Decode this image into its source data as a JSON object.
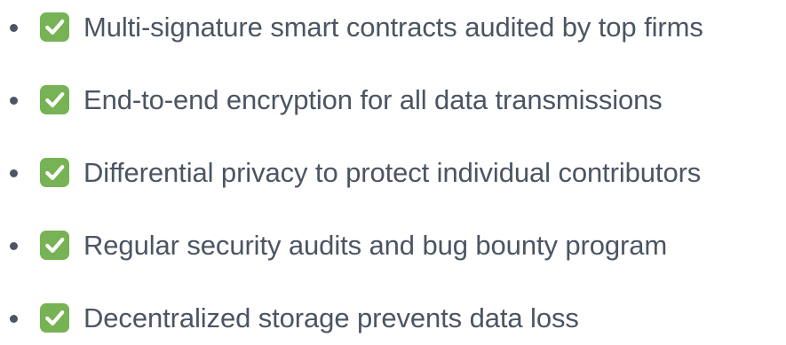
{
  "colors": {
    "text": "#4b5563",
    "bullet": "#4b5563",
    "check_background": "#77b255",
    "check_mark": "#ffffff"
  },
  "features": [
    {
      "icon": "check-mark-button-icon",
      "label": "Multi-signature smart contracts audited by top firms"
    },
    {
      "icon": "check-mark-button-icon",
      "label": "End-to-end encryption for all data transmissions"
    },
    {
      "icon": "check-mark-button-icon",
      "label": "Differential privacy to protect individual contributors"
    },
    {
      "icon": "check-mark-button-icon",
      "label": "Regular security audits and bug bounty program"
    },
    {
      "icon": "check-mark-button-icon",
      "label": "Decentralized storage prevents data loss"
    }
  ]
}
